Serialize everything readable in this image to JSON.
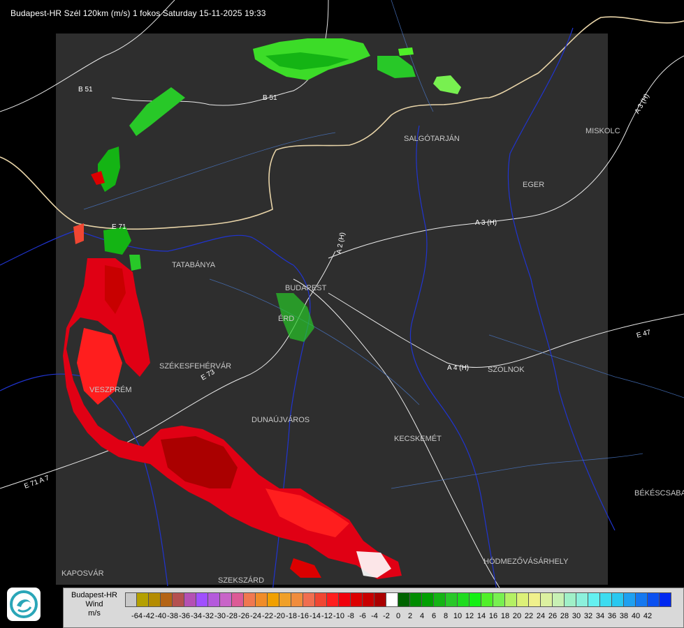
{
  "header": {
    "title": "Budapest-HR Szél 120km (m/s) 1 fokos Saturday 15-11-2025 19:33"
  },
  "map": {
    "cities": [
      "SALGÓTARJÁN",
      "MISKOLC",
      "EGER",
      "TATABÁNYA",
      "BUDAPEST",
      "ÉRD",
      "SZÉKESFEHÉRVÁR",
      "VESZPRÉM",
      "DUNAÚJVÁROS",
      "KECSKEMÉT",
      "SZOLNOK",
      "BÉKÉSCSABA",
      "HÓDMEZŐVÁSÁRHELY",
      "KAPOSVÁR",
      "SZEKSZÁRD"
    ],
    "roads": [
      "B 51",
      "B 51",
      "A 3 (H)",
      "A 3 (H)",
      "A 2 (H)",
      "A 4 (H)",
      "E 71",
      "E 71 A 7",
      "E 47",
      "E 73"
    ]
  },
  "legend": {
    "name": "Budapest-HR",
    "quantity": "Wind",
    "unit": "m/s",
    "colors": [
      "#c8c8c8",
      "#b4a000",
      "#b48c00",
      "#b46414",
      "#b45050",
      "#b450b4",
      "#a050ff",
      "#b45adc",
      "#c864c8",
      "#dc5a96",
      "#f07850",
      "#f08c28",
      "#f0a000",
      "#f0a028",
      "#f08c3c",
      "#f06e50",
      "#f04632",
      "#ff1e1e",
      "#f0000a",
      "#dc0000",
      "#c80000",
      "#aa0000",
      "#ffffff",
      "#006400",
      "#008c00",
      "#00a000",
      "#14b414",
      "#28c828",
      "#1edc1e",
      "#14f014",
      "#50f028",
      "#78f050",
      "#b4f064",
      "#dcf078",
      "#f0f08c",
      "#dcf0a0",
      "#c8f0b4",
      "#a0f0c8",
      "#8cf0dc",
      "#64f0f0",
      "#3cdcf0",
      "#28c8f0",
      "#1ea0f0",
      "#1478f0",
      "#0a50f0",
      "#0028f0"
    ],
    "ticks": [
      "-64",
      "-42",
      "-40",
      "-38",
      "-36",
      "-34",
      "-32",
      "-30",
      "-28",
      "-26",
      "-24",
      "-22",
      "-20",
      "-18",
      "-16",
      "-14",
      "-12",
      "-10",
      "-8",
      "-6",
      "-4",
      "-2",
      "0",
      "2",
      "4",
      "6",
      "8",
      "10",
      "12",
      "14",
      "16",
      "18",
      "20",
      "22",
      "24",
      "26",
      "28",
      "30",
      "32",
      "34",
      "36",
      "38",
      "40",
      "42"
    ]
  }
}
